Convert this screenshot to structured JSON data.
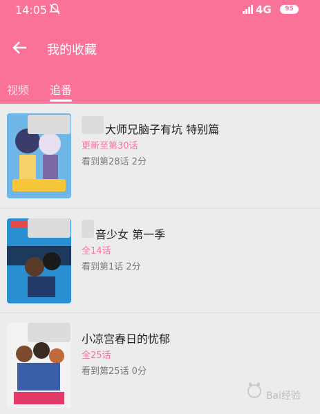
{
  "status_bar": {
    "time": "14:05",
    "network": "4G",
    "battery": "95"
  },
  "header": {
    "title": "我的收藏"
  },
  "tabs": [
    {
      "label": "视频"
    },
    {
      "label": "追番"
    }
  ],
  "items": [
    {
      "name": "大师兄脑子有坑 特别篇",
      "update": "更新至第30话",
      "progress": "看到第28话 2分"
    },
    {
      "name": "音少女 第一季",
      "update": "全14话",
      "progress": "看到第1话 2分"
    },
    {
      "name": "小凉宫春日的忧郁",
      "update": "全25话",
      "progress": "看到第25话 0分"
    }
  ],
  "watermark": {
    "text": "Bai经验"
  },
  "colors": {
    "accent": "#fb7299",
    "background": "#ececec"
  }
}
